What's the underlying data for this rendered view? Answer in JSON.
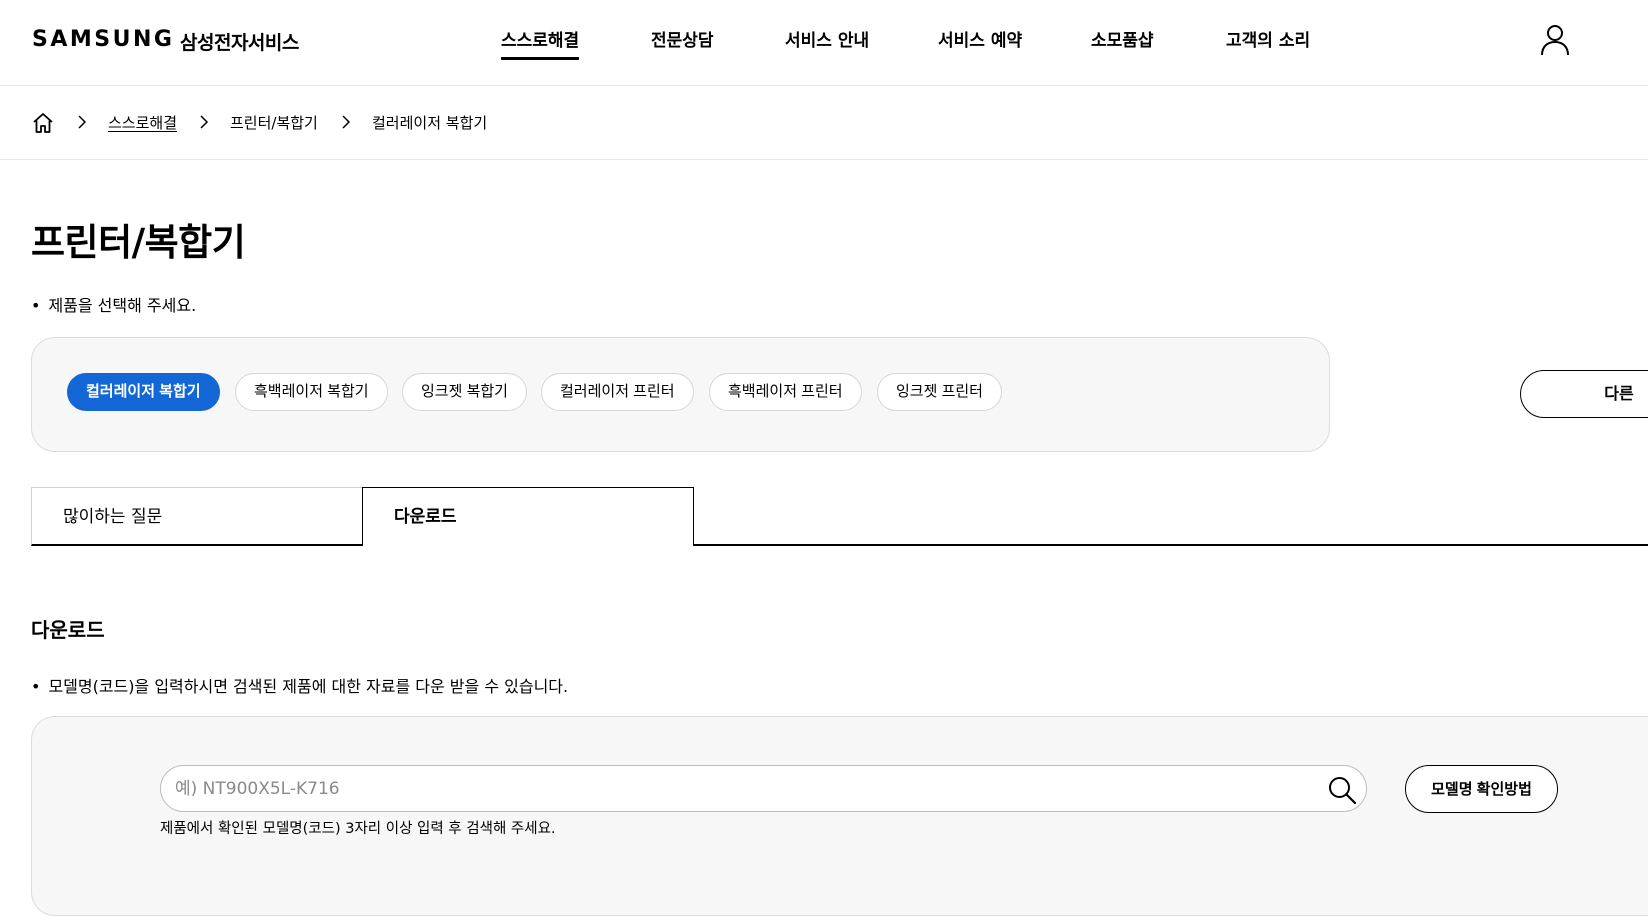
{
  "header": {
    "logo": "SAMSUNG",
    "logo_sub": "삼성전자서비스",
    "nav": [
      {
        "label": "스스로해결",
        "active": true
      },
      {
        "label": "전문상담"
      },
      {
        "label": "서비스 안내"
      },
      {
        "label": "서비스 예약"
      },
      {
        "label": "소모품샵"
      },
      {
        "label": "고객의 소리"
      }
    ],
    "user_icon": "user-icon"
  },
  "breadcrumb": {
    "home_icon": "home-icon",
    "items": [
      "스스로해결",
      "프린터/복합기",
      "컬러레이저 복합기"
    ]
  },
  "page": {
    "title": "프린터/복합기",
    "instruction": "제품을 선택해 주세요."
  },
  "categories": {
    "chips": [
      {
        "label": "컬러레이저 복합기",
        "active": true
      },
      {
        "label": "흑백레이저 복합기"
      },
      {
        "label": "잉크젯 복합기"
      },
      {
        "label": "컬러레이저 프린터"
      },
      {
        "label": "흑백레이저 프린터"
      },
      {
        "label": "잉크젯 프린터"
      }
    ],
    "other_label": "다른"
  },
  "tabs": [
    {
      "label": "많이하는 질문",
      "active": false
    },
    {
      "label": "다운로드",
      "active": true
    }
  ],
  "download": {
    "title": "다운로드",
    "description": "모델명(코드)을 입력하시면 검색된 제품에 대한 자료를 다운 받을 수 있습니다.",
    "search_placeholder": "예) NT900X5L-K716",
    "search_value": "",
    "model_button": "모델명 확인방법",
    "helper": "제품에서 확인된 모델명(코드) 3자리 이상 입력 후 검색해 주세요."
  },
  "colors": {
    "accent": "#1366d6",
    "panel_bg": "#f7f7f7",
    "border": "#dcdcdc"
  }
}
